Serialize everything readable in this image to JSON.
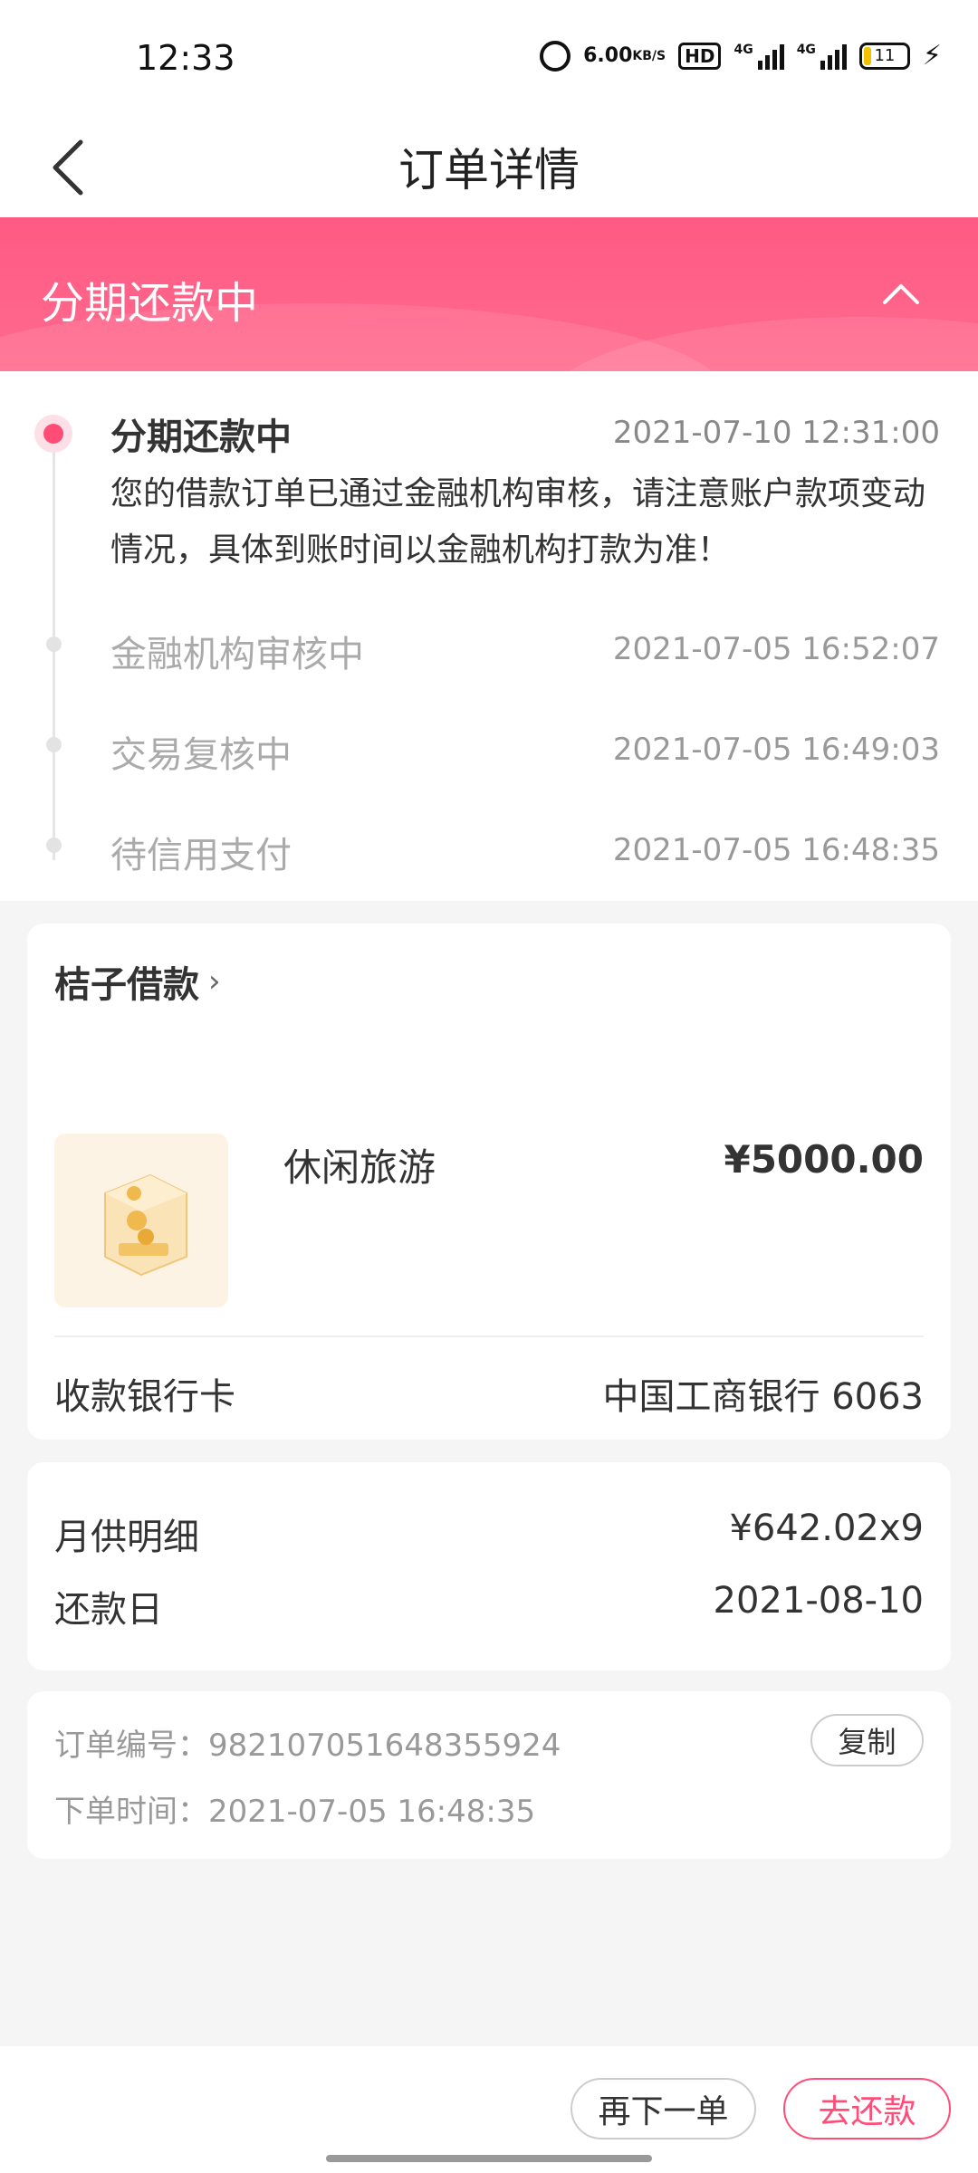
{
  "status_bar": {
    "time": "12:33",
    "net_speed": "6.00",
    "net_speed_unit": "KB/S",
    "hd_label": "HD",
    "sig1_tag": "4G",
    "sig2_tag": "4G",
    "battery": "11"
  },
  "nav": {
    "title": "订单详情"
  },
  "banner": {
    "status": "分期还款中"
  },
  "timeline": {
    "active": {
      "title": "分期还款中",
      "time": "2021-07-10 12:31:00",
      "desc": "您的借款订单已通过金融机构审核，请注意账户款项变动情况，具体到账时间以金融机构打款为准！"
    },
    "steps": [
      {
        "title": "金融机构审核中",
        "time": "2021-07-05 16:52:07"
      },
      {
        "title": "交易复核中",
        "time": "2021-07-05 16:49:03"
      },
      {
        "title": "待信用支付",
        "time": "2021-07-05 16:48:35"
      }
    ]
  },
  "order": {
    "merchant": "桔子借款",
    "product_name": "休闲旅游",
    "price": "¥5000.00",
    "bank_label": "收款银行卡",
    "bank_value": "中国工商银行 6063"
  },
  "repayment": {
    "monthly_label": "月供明细",
    "monthly_value": "¥642.02x9",
    "due_label": "还款日",
    "due_value": "2021-08-10"
  },
  "meta": {
    "order_no": "订单编号：982107051648355924",
    "order_time": "下单时间：2021-07-05 16:48:35",
    "copy_label": "复制"
  },
  "actions": {
    "reorder": "再下一单",
    "repay": "去还款"
  },
  "colors": {
    "accent": "#ff4d78",
    "banner": "#ff6a8e"
  }
}
